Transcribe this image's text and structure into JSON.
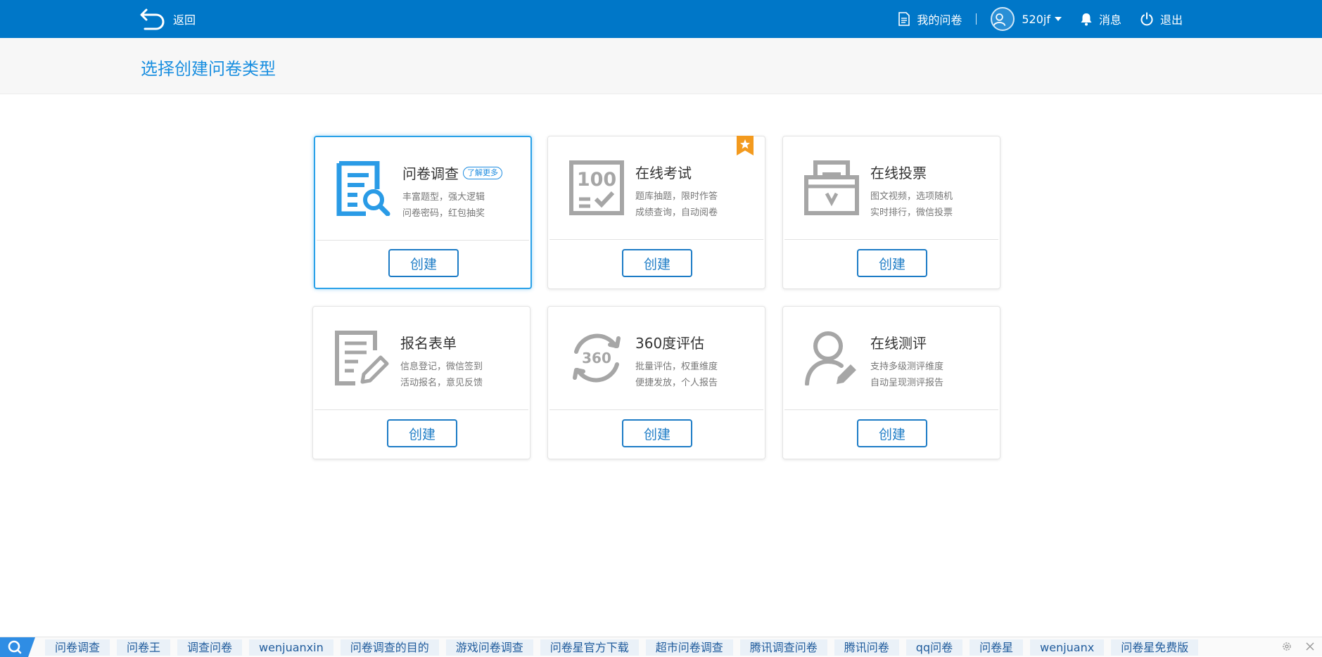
{
  "header": {
    "back_label": "返回",
    "my_surveys_label": "我的问卷",
    "username": "520jf",
    "messages_label": "消息",
    "logout_label": "退出"
  },
  "page_title": "选择创建问卷类型",
  "colors": {
    "topbar": "#0077c8",
    "accent": "#1d7cc6",
    "icon_active": "#2a9be6",
    "icon_inactive": "#a6a6a6",
    "ribbon": "#f39a1e"
  },
  "cards": [
    {
      "icon": "survey-search-icon",
      "title": "问卷调查",
      "badge": "了解更多",
      "desc1": "丰富题型，强大逻辑",
      "desc2": "问卷密码，红包抽奖",
      "button": "创建",
      "selected": true
    },
    {
      "icon": "exam-100-icon",
      "title": "在线考试",
      "desc1": "题库抽题，限时作答",
      "desc2": "成绩查询，自动阅卷",
      "button": "创建",
      "featured": true
    },
    {
      "icon": "ballot-box-icon",
      "title": "在线投票",
      "desc1": "图文视频，选项随机",
      "desc2": "实时排行，微信投票",
      "button": "创建"
    },
    {
      "icon": "form-edit-icon",
      "title": "报名表单",
      "desc1": "信息登记，微信签到",
      "desc2": "活动报名，意见反馈",
      "button": "创建"
    },
    {
      "icon": "rotate-360-icon",
      "title": "360度评估",
      "desc1": "批量评估，权重维度",
      "desc2": "便捷发放，个人报告",
      "button": "创建"
    },
    {
      "icon": "person-edit-icon",
      "title": "在线测评",
      "desc1": "支持多级测评维度",
      "desc2": "自动呈现测评报告",
      "button": "创建"
    }
  ],
  "bottom_links": [
    "问卷调查",
    "问卷王",
    "调查问卷",
    "wenjuanxin",
    "问卷调查的目的",
    "游戏问卷调查",
    "问卷星官方下载",
    "超市问卷调查",
    "腾讯调查问卷",
    "腾讯问卷",
    "qq问卷",
    "问卷星",
    "wenjuanx",
    "问卷星免费版"
  ]
}
